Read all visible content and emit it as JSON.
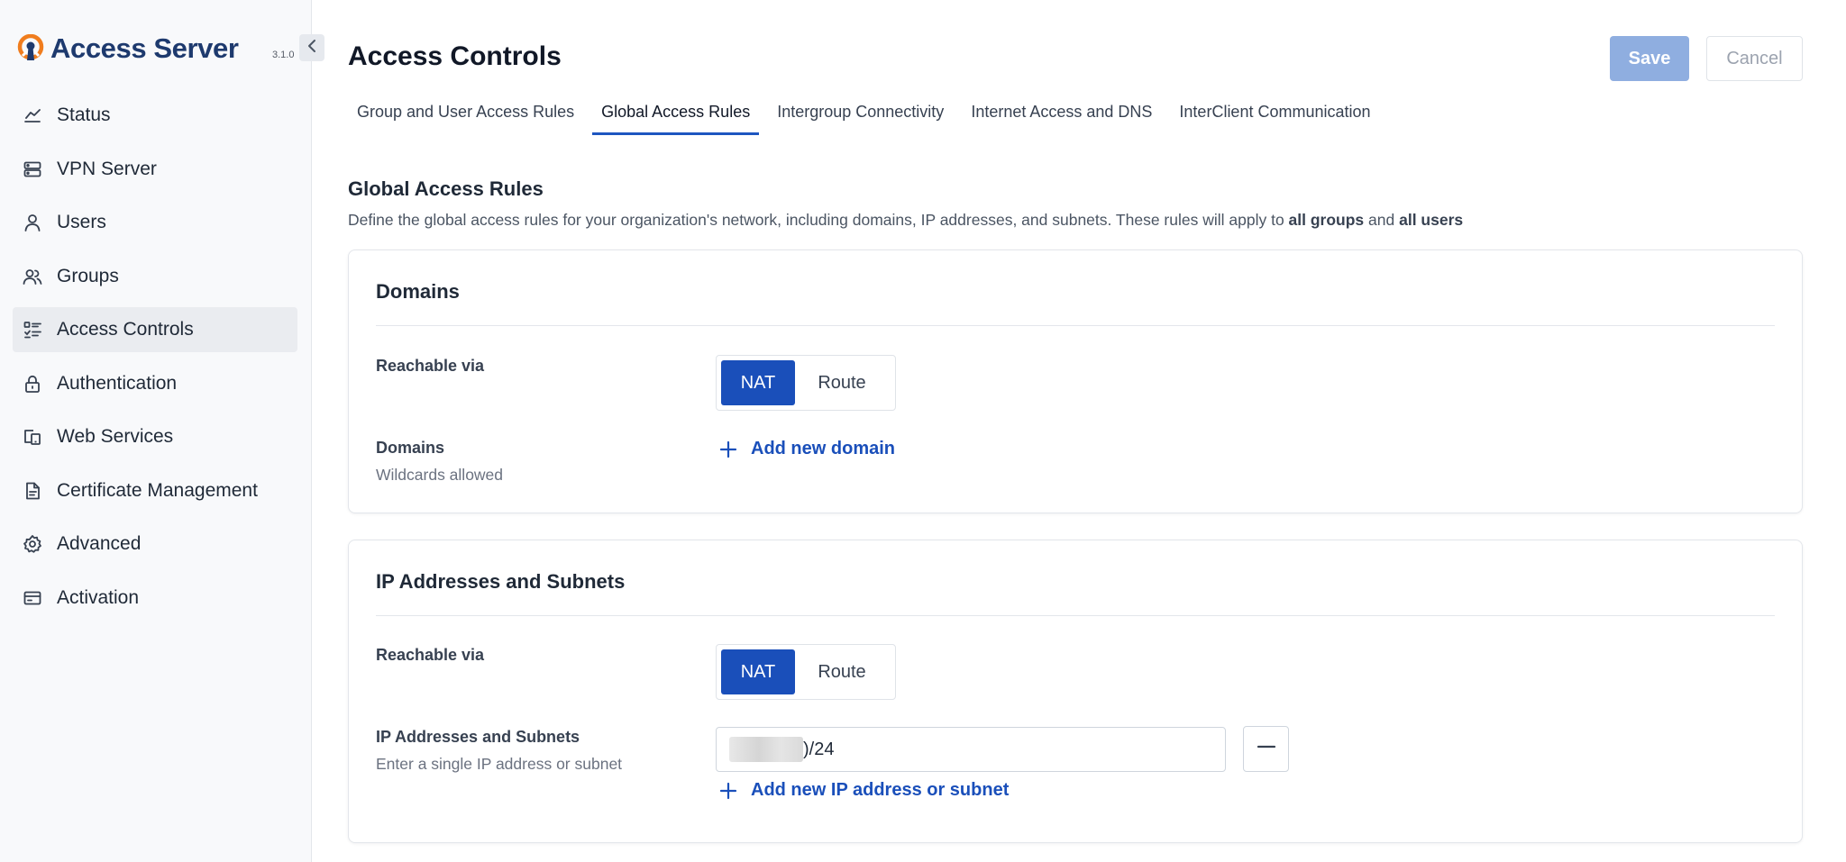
{
  "app": {
    "brand_name": "Access Server",
    "version": "3.1.0",
    "brand_color": "#f07d1e",
    "accent_color": "#1a4fba"
  },
  "sidebar": {
    "items": [
      {
        "label": "Status",
        "icon": "chart-line-icon"
      },
      {
        "label": "VPN Server",
        "icon": "server-icon"
      },
      {
        "label": "Users",
        "icon": "user-icon"
      },
      {
        "label": "Groups",
        "icon": "users-icon"
      },
      {
        "label": "Access Controls",
        "icon": "list-checks-icon",
        "active": true
      },
      {
        "label": "Authentication",
        "icon": "lock-icon"
      },
      {
        "label": "Web Services",
        "icon": "devices-icon"
      },
      {
        "label": "Certificate Management",
        "icon": "document-icon"
      },
      {
        "label": "Advanced",
        "icon": "gear-icon"
      },
      {
        "label": "Activation",
        "icon": "credit-card-icon"
      }
    ]
  },
  "header": {
    "title": "Access Controls",
    "save_label": "Save",
    "cancel_label": "Cancel"
  },
  "tabs": [
    {
      "label": "Group and User Access Rules",
      "active": false
    },
    {
      "label": "Global Access Rules",
      "active": true
    },
    {
      "label": "Intergroup Connectivity",
      "active": false
    },
    {
      "label": "Internet Access and DNS",
      "active": false
    },
    {
      "label": "InterClient Communication",
      "active": false
    }
  ],
  "section": {
    "title": "Global Access Rules",
    "desc_prefix": "Define the global access rules for your organization's network, including domains, IP addresses, and subnets. These rules will apply to ",
    "desc_bold1": "all groups",
    "desc_mid": " and ",
    "desc_bold2": "all users"
  },
  "domains_card": {
    "title": "Domains",
    "reachable_label": "Reachable via",
    "toggle_on": "NAT",
    "toggle_off": "Route",
    "selected": "NAT",
    "domains_label": "Domains",
    "domains_help": "Wildcards allowed",
    "add_label": "Add new domain"
  },
  "ip_card": {
    "title": "IP Addresses and Subnets",
    "reachable_label": "Reachable via",
    "toggle_on": "NAT",
    "toggle_off": "Route",
    "selected": "NAT",
    "ip_label": "IP Addresses and Subnets",
    "ip_help": "Enter a single IP address or subnet",
    "ip_value_visible": ")/24",
    "add_label": "Add new IP address or subnet"
  }
}
